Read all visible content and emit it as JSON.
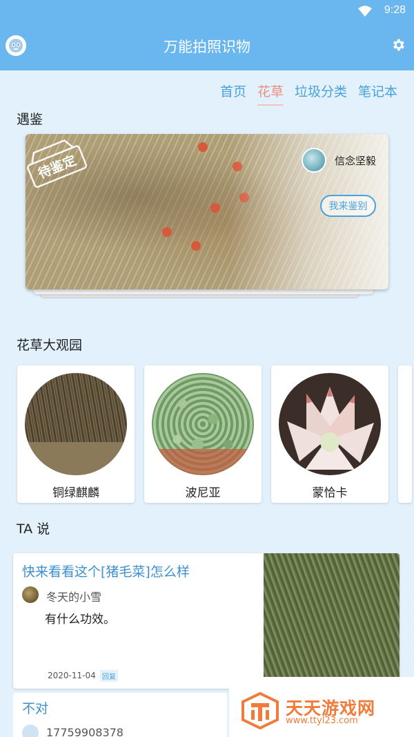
{
  "status_bar": {
    "time": "9:28"
  },
  "app_bar": {
    "title": "万能拍照识物",
    "left_icon": "avatar-face-icon",
    "right_icon": "gear-icon"
  },
  "tabs": [
    {
      "label": "首页",
      "active": false
    },
    {
      "label": "花草",
      "active": true
    },
    {
      "label": "垃圾分类",
      "active": false
    },
    {
      "label": "笔记本",
      "active": false
    }
  ],
  "sections": {
    "meet": "遇鉴",
    "garden": "花草大观园",
    "ta_say": "TA 说"
  },
  "meet_card": {
    "stamp_text": "待鉴定",
    "user_name": "信念坚毅",
    "button_label": "我来鉴别"
  },
  "plants": [
    {
      "name": "铜绿麒麟"
    },
    {
      "name": "波尼亚"
    },
    {
      "name": "蒙恰卡"
    }
  ],
  "posts": [
    {
      "title": "快来看看这个[猪毛菜]怎么样",
      "user": "冬天的小雪",
      "body": "有什么功效。",
      "date": "2020-11-04",
      "reply": "回复"
    },
    {
      "title": "不对",
      "user": "17759908378"
    }
  ],
  "watermark": {
    "text": "天天游戏网",
    "url": "www.ttyl23.com"
  },
  "colors": {
    "primary": "#6ab6ef",
    "accent": "#ee8e7f",
    "link": "#3b8fd0",
    "background": "#e2f1fb"
  }
}
